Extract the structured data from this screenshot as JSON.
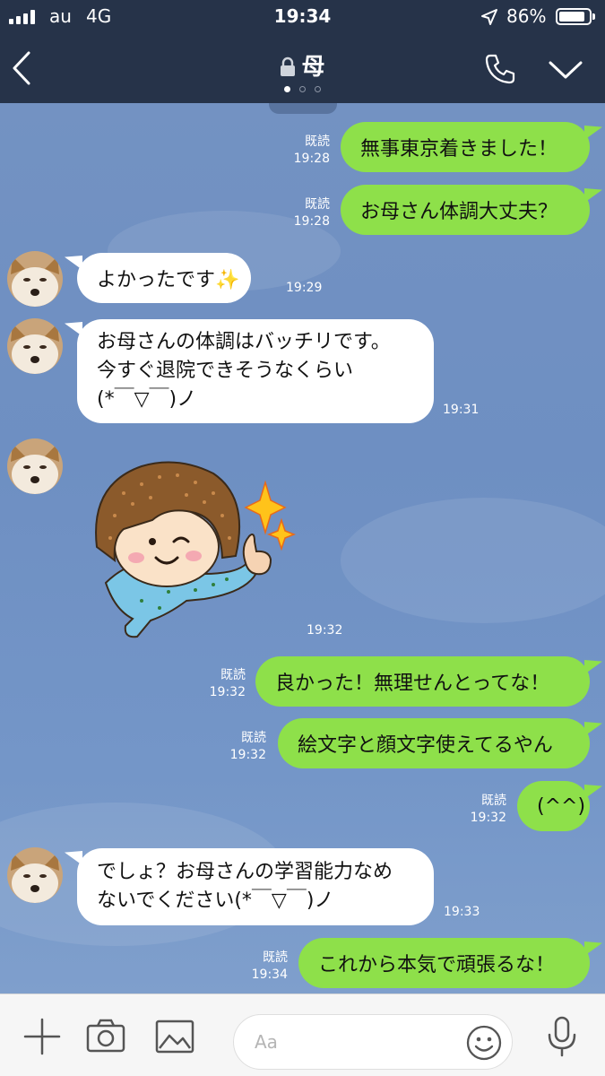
{
  "status_bar": {
    "carrier": "au",
    "network": "4G",
    "time": "19:34",
    "battery": "86%"
  },
  "header": {
    "title": "母",
    "page_dots": 3,
    "active_dot": 0
  },
  "messages": [
    {
      "side": "me",
      "text": "無事東京着きました！",
      "read": "既読",
      "time": "19:28"
    },
    {
      "side": "me",
      "text": "お母さん体調大丈夫？",
      "read": "既読",
      "time": "19:28"
    },
    {
      "side": "them",
      "text": "よかったです✨",
      "time": "19:29"
    },
    {
      "side": "them",
      "lines": [
        "お母さんの体調はバッチリです。",
        "今すぐ退院できそうなくらい",
        "(*￣▽￣)ノ"
      ],
      "time": "19:31"
    },
    {
      "side": "them",
      "type": "sticker",
      "sticker": "girl-thumbs-up-sticker",
      "time": "19:32"
    },
    {
      "side": "me",
      "text": "良かった！無理せんとってな！",
      "read": "既読",
      "time": "19:32"
    },
    {
      "side": "me",
      "text": "絵文字と顔文字使えてるやん",
      "read": "既読",
      "time": "19:32"
    },
    {
      "side": "me",
      "text": "(^^)",
      "read": "既読",
      "time": "19:32"
    },
    {
      "side": "them",
      "lines": [
        "でしょ？お母さんの学習能力なめ",
        "ないでください(*￣▽￣)ノ"
      ],
      "time": "19:33"
    },
    {
      "side": "me",
      "text": "これから本気で頑張るな！",
      "read": "既読",
      "time": "19:34"
    }
  ],
  "composer": {
    "placeholder": "Aa"
  },
  "colors": {
    "header_bg": "#263349",
    "chat_bg": "#7895c4",
    "my_bubble": "#8ee04a",
    "their_bubble": "#ffffff"
  }
}
